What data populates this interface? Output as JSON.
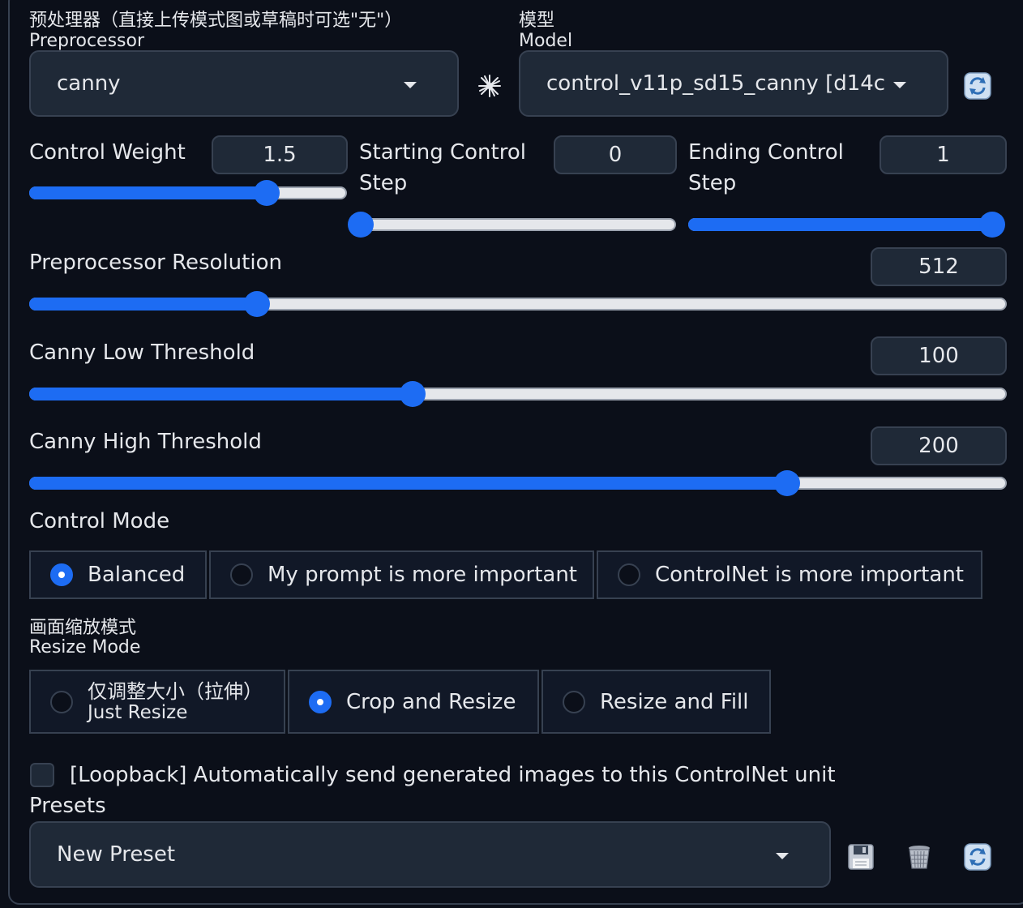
{
  "preprocessor": {
    "label_cn": "预处理器（直接上传模式图或草稿时可选\"无\"）",
    "label_en": "Preprocessor",
    "value": "canny"
  },
  "model": {
    "label_cn": "模型",
    "label_en": "Model",
    "value": "control_v11p_sd15_canny [d14c"
  },
  "control_weight": {
    "label": "Control Weight",
    "value": "1.5",
    "fraction": 0.75
  },
  "starting_step": {
    "label_line1": "Starting Control",
    "label_line2": "Step",
    "value": "0",
    "fraction": 0.0
  },
  "ending_step": {
    "label_line1": "Ending Control",
    "label_line2": "Step",
    "value": "1",
    "fraction": 1.0
  },
  "preprocessor_resolution": {
    "label": "Preprocessor Resolution",
    "value": "512",
    "fraction": 0.232
  },
  "canny_low": {
    "label": "Canny Low Threshold",
    "value": "100",
    "fraction": 0.392
  },
  "canny_high": {
    "label": "Canny High Threshold",
    "value": "200",
    "fraction": 0.776
  },
  "control_mode": {
    "label": "Control Mode",
    "options": [
      "Balanced",
      "My prompt is more important",
      "ControlNet is more important"
    ],
    "selected": 0
  },
  "resize_mode": {
    "label_cn": "画面缩放模式",
    "label_en": "Resize Mode",
    "option0_cn": "仅调整大小（拉伸）",
    "option0_en": "Just Resize",
    "option1": "Crop and Resize",
    "option2": "Resize and Fill",
    "selected": 1
  },
  "loopback": {
    "label": "[Loopback] Automatically send generated images to this ControlNet unit",
    "checked": false
  },
  "presets": {
    "label": "Presets",
    "value": "New Preset"
  },
  "icons": [
    "sparkle-icon",
    "refresh-icon",
    "save-icon",
    "trash-icon",
    "refresh-icon"
  ],
  "colors": {
    "accent": "#1d6cf3",
    "background": "#0b0f19",
    "input": "#1f2937"
  }
}
